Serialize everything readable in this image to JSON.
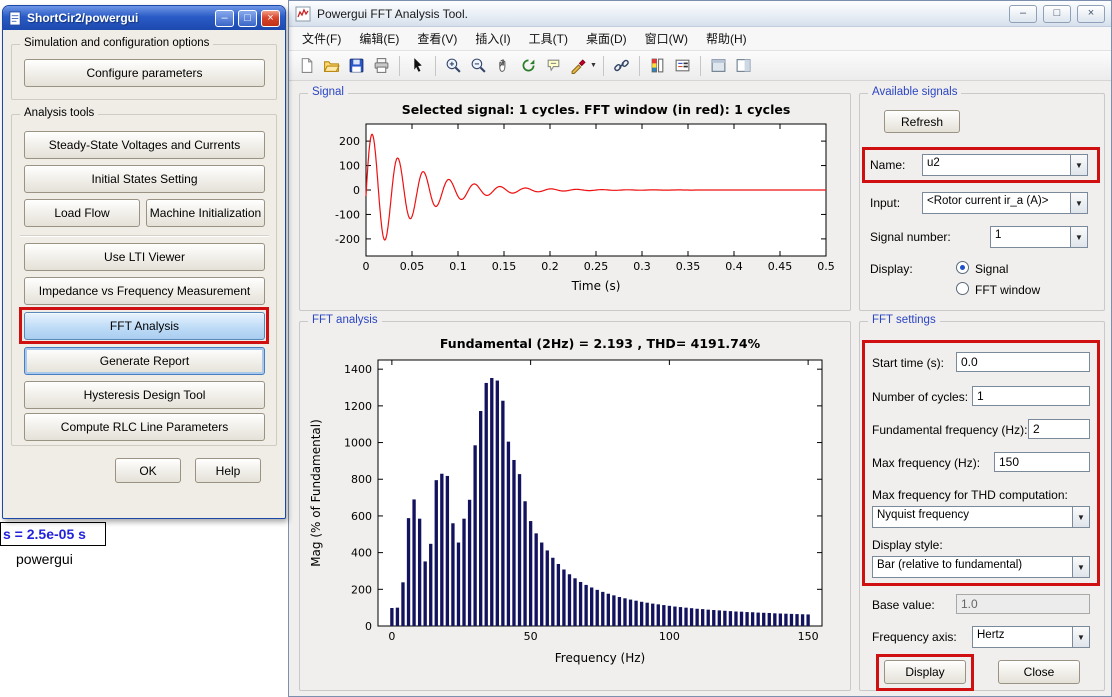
{
  "left_window": {
    "title": "ShortCir2/powergui",
    "groups": {
      "sim": {
        "label": "Simulation and configuration options",
        "configure_btn": "Configure parameters"
      },
      "analysis": {
        "label": "Analysis tools",
        "buttons": [
          "Steady-State Voltages and Currents",
          "Initial States Setting",
          "Load Flow",
          "Machine Initialization",
          "Use LTI Viewer",
          "Impedance vs Frequency Measurement",
          "FFT Analysis",
          "Generate Report",
          "Hysteresis Design Tool",
          "Compute RLC Line Parameters"
        ]
      }
    },
    "ok_btn": "OK",
    "help_btn": "Help"
  },
  "canvas": {
    "sample_time_label": "s = 2.5e-05 s",
    "block_label": "powergui"
  },
  "fft_window": {
    "title": "Powergui FFT Analysis Tool.",
    "menus": [
      "文件(F)",
      "编辑(E)",
      "查看(V)",
      "插入(I)",
      "工具(T)",
      "桌面(D)",
      "窗口(W)",
      "帮助(H)"
    ],
    "toolbar_icons": [
      "new-figure",
      "open-file",
      "save-figure",
      "print-figure",
      "pointer",
      "zoom-in",
      "zoom-out",
      "pan",
      "rotate-3d",
      "data-cursor",
      "brush-data",
      "link-plot",
      "insert-colorbar",
      "insert-legend",
      "hide-plot-tools",
      "show-plot-tools"
    ],
    "panels": {
      "signal": {
        "label": "Signal"
      },
      "fft": {
        "label": "FFT analysis"
      },
      "available": {
        "label": "Available signals",
        "refresh_btn": "Refresh",
        "name_label": "Name:",
        "name_value": "u2",
        "input_label": "Input:",
        "input_value": "<Rotor current ir_a (A)>",
        "signal_number_label": "Signal number:",
        "signal_number_value": "1",
        "display_label": "Display:",
        "radio_signal": "Signal",
        "radio_fft": "FFT window"
      },
      "settings": {
        "label": "FFT settings",
        "start_time_label": "Start time (s):",
        "start_time_value": "0.0",
        "cycles_label": "Number of cycles:",
        "cycles_value": "1",
        "fundamental_label": "Fundamental frequency (Hz):",
        "fundamental_value": "2",
        "maxfreq_label": "Max frequency (Hz):",
        "maxfreq_value": "150",
        "thd_label": "Max frequency for THD computation:",
        "thd_value": "Nyquist frequency",
        "style_label": "Display style:",
        "style_value": "Bar (relative to fundamental)",
        "base_label": "Base value:",
        "base_value": "1.0",
        "axis_label": "Frequency axis:",
        "axis_value": "Hertz",
        "display_btn": "Display",
        "close_btn": "Close"
      }
    }
  },
  "chart_data": [
    {
      "type": "line",
      "name": "selected-signal",
      "title": "Selected signal: 1 cycles. FFT window (in red): 1 cycles",
      "xlabel": "Time (s)",
      "x_ticks": [
        0,
        0.05,
        0.1,
        0.15,
        0.2,
        0.25,
        0.3,
        0.35,
        0.4,
        0.45,
        0.5
      ],
      "x_tick_labels": [
        "0",
        "0.05",
        "0.1",
        "0.15",
        "0.2",
        "0.25",
        "0.3",
        "0.35",
        "0.4",
        "0.45",
        "0.5"
      ],
      "y_ticks": [
        -200,
        -100,
        0,
        100,
        200
      ],
      "xlim": [
        0,
        0.5
      ],
      "ylim": [
        -270,
        270
      ],
      "line_color": "#ee1111",
      "waveform": {
        "kind": "damped_sine",
        "amplitude": 285,
        "frequency_hz": 36,
        "decay_tau_s": 0.05,
        "dc_amplitude": -24,
        "dc_tau_s": 0.05,
        "duration_s": 0.5
      }
    },
    {
      "type": "bar",
      "name": "fft-spectrum",
      "title": "Fundamental (2Hz) = 2.193 , THD= 4191.74%",
      "xlabel": "Frequency (Hz)",
      "ylabel": "Mag (% of Fundamental)",
      "bar_color": "#12125e",
      "freq_start_hz": 0,
      "freq_step_hz": 2,
      "values": [
        98,
        100,
        238,
        588,
        690,
        585,
        352,
        448,
        795,
        830,
        818,
        560,
        455,
        585,
        688,
        985,
        1172,
        1325,
        1352,
        1338,
        1228,
        1005,
        905,
        828,
        680,
        572,
        505,
        455,
        412,
        372,
        338,
        308,
        282,
        260,
        240,
        224,
        210,
        197,
        186,
        176,
        167,
        158,
        151,
        144,
        138,
        132,
        127,
        122,
        118,
        114,
        110,
        106,
        103,
        100,
        97,
        94,
        92,
        89,
        87,
        85,
        83,
        81,
        79,
        78,
        76,
        75,
        73,
        72,
        71,
        69,
        68,
        67,
        66,
        65,
        64,
        63
      ],
      "x_ticks": [
        0,
        50,
        100,
        150
      ],
      "y_ticks": [
        0,
        200,
        400,
        600,
        800,
        1000,
        1200,
        1400
      ],
      "xlim": [
        -5,
        155
      ],
      "ylim": [
        0,
        1450
      ]
    }
  ]
}
